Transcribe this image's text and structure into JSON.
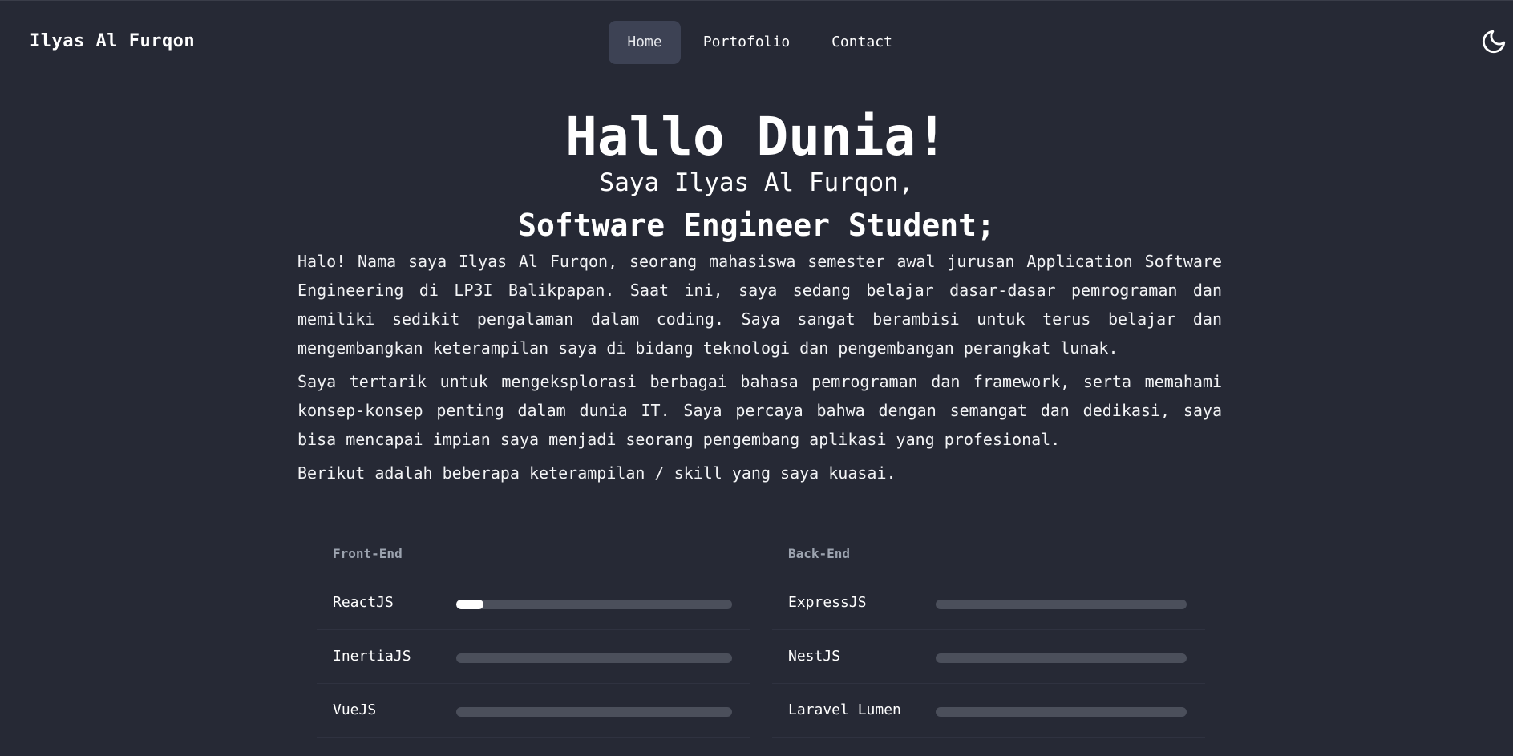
{
  "nav": {
    "brand": "Ilyas Al Furqon",
    "links": [
      {
        "label": "Home",
        "active": true
      },
      {
        "label": "Portofolio",
        "active": false
      },
      {
        "label": "Contact",
        "active": false
      }
    ],
    "theme_icon": "moon-icon"
  },
  "hero": {
    "title": "Hallo Dunia!",
    "subtitle": "Saya Ilyas Al Furqon,",
    "role": "Software Engineer Student;"
  },
  "about": {
    "p1": "Halo! Nama saya Ilyas Al Furqon, seorang mahasiswa semester awal jurusan Application Software Engineering di LP3I Balikpapan. Saat ini, saya sedang belajar dasar-dasar pemrograman dan memiliki sedikit pengalaman dalam coding. Saya sangat berambisi untuk terus belajar dan mengembangkan keterampilan saya di bidang teknologi dan pengembangan perangkat lunak.",
    "p2": "Saya tertarik untuk mengeksplorasi berbagai bahasa pemrograman dan framework, serta memahami konsep-konsep penting dalam dunia IT. Saya percaya bahwa dengan semangat dan dedikasi, saya bisa mencapai impian saya menjadi seorang pengembang aplikasi yang profesional.",
    "p3": "Berikut adalah beberapa keterampilan / skill yang saya kuasai."
  },
  "skills": {
    "frontend": {
      "heading": "Front-End",
      "items": [
        {
          "name": "ReactJS",
          "level": 0.1
        },
        {
          "name": "InertiaJS",
          "level": 0
        },
        {
          "name": "VueJS",
          "level": 0
        }
      ]
    },
    "backend": {
      "heading": "Back-End",
      "items": [
        {
          "name": "ExpressJS",
          "level": 0
        },
        {
          "name": "NestJS",
          "level": 0
        },
        {
          "name": "Laravel Lumen",
          "level": 0
        }
      ]
    }
  },
  "colors": {
    "background": "#262935",
    "active_nav": "#3d4254",
    "track": "#4b4f5b",
    "fill": "#ffffff"
  }
}
